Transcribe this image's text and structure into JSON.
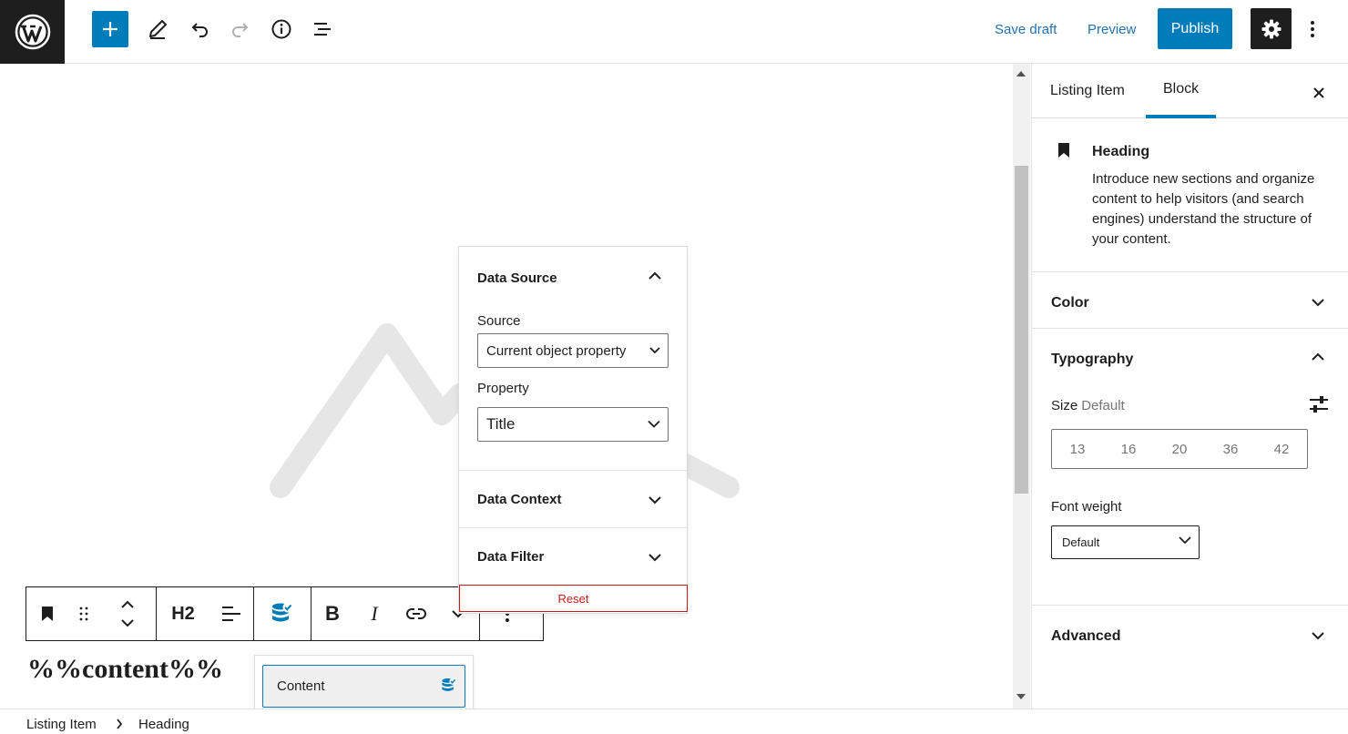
{
  "topbar": {
    "save_draft": "Save draft",
    "preview": "Preview",
    "publish": "Publish",
    "accent": "#007cba"
  },
  "icons": {
    "logo": "wordpress-icon",
    "add": "plus-icon",
    "tools": "pencil-icon",
    "undo": "undo-icon",
    "redo": "redo-icon",
    "details": "info-icon",
    "outline": "list-view-icon",
    "settings": "gear-icon",
    "more": "kebab-icon"
  },
  "block_toolbar": {
    "heading_level": "H2"
  },
  "editor": {
    "heading_content": "%%content%%"
  },
  "data_popover": {
    "data_source_title": "Data Source",
    "source_label": "Source",
    "source_value": "Current object property",
    "property_label": "Property",
    "property_value": "Title",
    "data_context_title": "Data Context",
    "data_filter_title": "Data Filter",
    "reset_label": "Reset"
  },
  "content_suggest": {
    "item_label": "Content"
  },
  "breadcrumb": {
    "items": [
      "Listing Item",
      "Heading"
    ]
  },
  "sidebar": {
    "tabs": [
      "Listing Item",
      "Block"
    ],
    "active_tab": "Block",
    "block_card": {
      "title": "Heading",
      "description": "Introduce new sections and organize content to help visitors (and search engines) understand the structure of your content."
    },
    "panels": {
      "color": "Color",
      "typography": "Typography",
      "advanced": "Advanced"
    },
    "typography": {
      "size_label": "Size",
      "size_value": "Default",
      "size_options": [
        "13",
        "16",
        "20",
        "36",
        "42"
      ],
      "font_weight_label": "Font weight",
      "font_weight_value": "Default"
    }
  }
}
